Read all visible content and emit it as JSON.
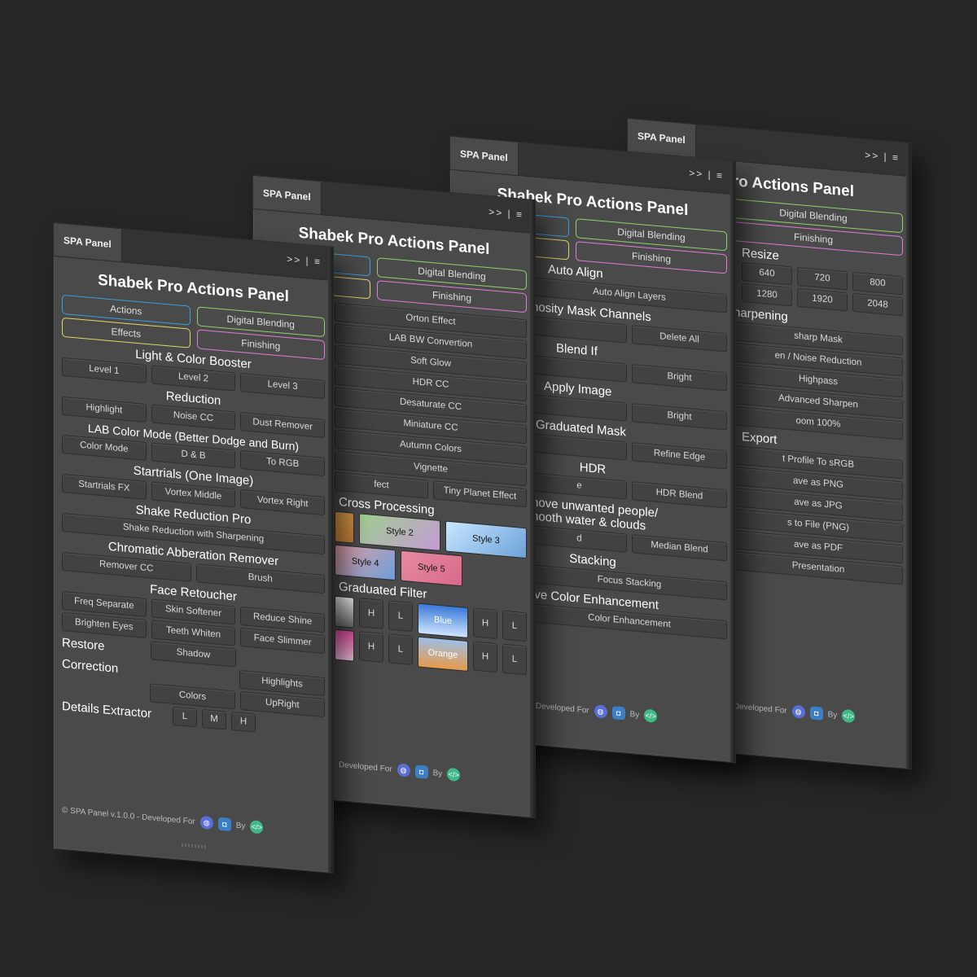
{
  "tab_label": "SPA Panel",
  "tab_controls": ">> | ≡",
  "panel_title": "Shabek Pro Actions Panel",
  "categories": [
    "Actions",
    "Digital Blending",
    "Effects",
    "Finishing"
  ],
  "panel1": {
    "s1": "Light & Color Booster",
    "b1": [
      "Level 1",
      "Level 2",
      "Level 3"
    ],
    "s2": "Reduction",
    "b2": [
      "Highlight",
      "Noise CC",
      "Dust Remover"
    ],
    "s3": "LAB Color Mode (Better Dodge and Burn)",
    "b3": [
      "Color Mode",
      "D & B",
      "To RGB"
    ],
    "s4": "Startrials (One Image)",
    "b4": [
      "Startrials FX",
      "Vortex Middle",
      "Vortex Right"
    ],
    "s5": "Shake Reduction Pro",
    "b5": [
      "Shake Reduction with Sharpening"
    ],
    "s6": "Chromatic Abberation Remover",
    "b6": [
      "Remover CC",
      "Brush"
    ],
    "s7": "Face Retoucher",
    "b7": [
      "Freq Separate",
      "Skin Softener",
      "Reduce Shine"
    ],
    "b8": [
      "Brighten Eyes",
      "Teeth Whiten",
      "Face Slimmer"
    ],
    "s9": "Restore",
    "b9": "Shadow",
    "s10": "Correction",
    "b10": [
      "Highlights"
    ],
    "b11": [
      "Colors",
      "UpRight"
    ],
    "s12": "Details Extractor",
    "b12": [
      "L",
      "M",
      "H"
    ]
  },
  "panel2": {
    "effects": [
      "Orton Effect",
      "LAB BW Convertion",
      "Soft Glow",
      "HDR CC",
      "Desaturate CC",
      "Miniature CC",
      "Autumn Colors",
      "Vignette"
    ],
    "last_row": [
      "fect",
      "Tiny Planet Effect"
    ],
    "cross_title": "Cross Processing",
    "styles": [
      "Style 2",
      "Style 3",
      "Style 4",
      "Style 5"
    ],
    "grad_title": "Graduated Filter",
    "grads": [
      "Blue",
      "Orange"
    ],
    "hl": [
      "H",
      "L"
    ]
  },
  "panel3": {
    "s1": "Auto Align",
    "b1": "Auto Align Layers",
    "s2": "nosity Mask Channels",
    "b2": "Delete All",
    "s3": "Blend If",
    "b3": "Bright",
    "s4": "Apply Image",
    "b4": "Bright",
    "s5": "Graduated Mask",
    "b5": "Refine Edge",
    "s6": "HDR",
    "b6": [
      "e",
      "HDR Blend"
    ],
    "s7": "nove unwanted people/ nooth water & clouds",
    "b7": [
      "d",
      "Median Blend"
    ],
    "s8": "Stacking",
    "b8": "Focus Stacking",
    "s9": "ive Color Enhancement",
    "b9": "Color Enhancement"
  },
  "panel4": {
    "title_partial": "ro Actions Panel",
    "s1": "Resize",
    "b1": [
      "640",
      "720",
      "800"
    ],
    "b2": [
      "1280",
      "1920",
      "2048"
    ],
    "s2": "harpening",
    "items": [
      "sharp Mask",
      "en / Noise Reduction",
      "Highpass",
      "Advanced Sharpen",
      "oom 100%"
    ],
    "s3": "Export",
    "exports": [
      "t Profile To sRGB",
      "ave as PNG",
      "ave as JPG",
      "s to File (PNG)",
      "ave as PDF",
      "Presentation"
    ]
  },
  "footer": {
    "copyright": "© SPA Panel v.1.0.0 - Developed For",
    "developed": "Developed For",
    "by": "By"
  },
  "colors": {
    "blue": "#3a9fe0",
    "green": "#8fd06a",
    "yellow": "#e6d76a",
    "pink": "#e27ad8"
  }
}
